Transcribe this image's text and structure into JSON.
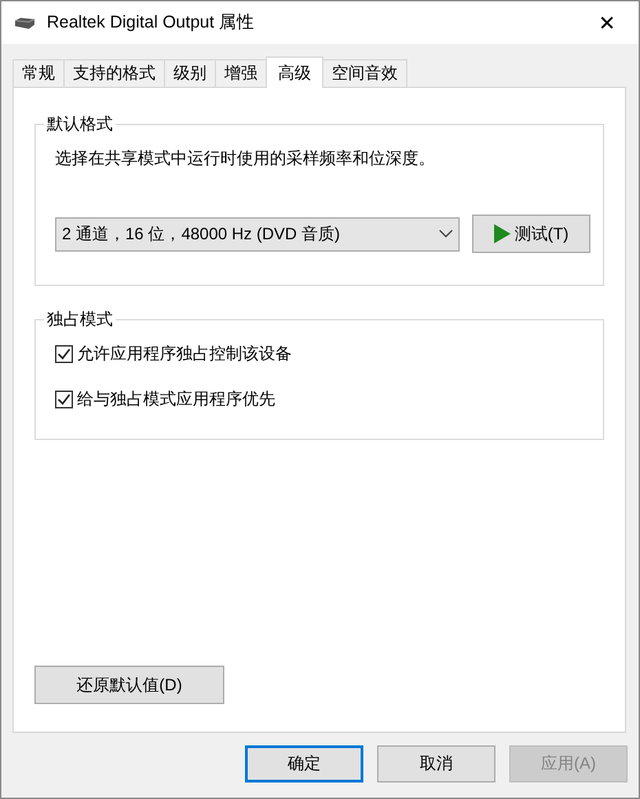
{
  "window": {
    "title": "Realtek Digital Output 属性",
    "close": "✕"
  },
  "tabs": [
    {
      "label": "常规",
      "selected": false
    },
    {
      "label": "支持的格式",
      "selected": false
    },
    {
      "label": "级别",
      "selected": false
    },
    {
      "label": "增强",
      "selected": false
    },
    {
      "label": "高级",
      "selected": true
    },
    {
      "label": "空间音效",
      "selected": false
    }
  ],
  "default_format": {
    "title": "默认格式",
    "description": "选择在共享模式中运行时使用的采样频率和位深度。",
    "format_dropdown": {
      "value": "2 通道，16 位，48000 Hz (DVD 音质)"
    },
    "test_button": "测试(T)"
  },
  "exclusive_mode": {
    "title": "独占模式",
    "options": [
      {
        "label": "允许应用程序独占控制该设备",
        "checked": true
      },
      {
        "label": "给与独占模式应用程序优先",
        "checked": true
      }
    ]
  },
  "restore_button": "还原默认值(D)",
  "buttons": [
    {
      "label": "确定",
      "default": true,
      "disabled": false
    },
    {
      "label": "取消",
      "default": false,
      "disabled": false
    },
    {
      "label": "应用(A)",
      "default": false,
      "disabled": true
    }
  ]
}
